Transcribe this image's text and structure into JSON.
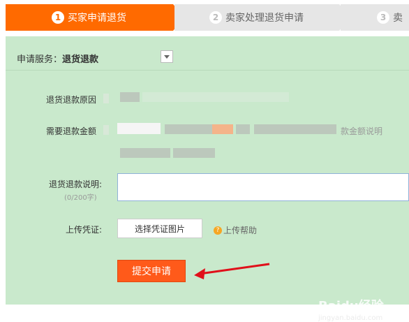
{
  "steps": [
    {
      "num": "1",
      "label": "买家申请退货"
    },
    {
      "num": "2",
      "label": "卖家处理退货申请"
    },
    {
      "num": "3",
      "label": "卖"
    }
  ],
  "service": {
    "label": "申请服务：",
    "value": "退货退款"
  },
  "form": {
    "reason_label": "退货退款原因",
    "amount_label": "需要退款金额",
    "amount_note": "款金额说明",
    "desc_label": "退货退款说明:",
    "desc_count": "(0/200字)",
    "voucher_label": "上传凭证:",
    "upload_button": "选择凭证图片",
    "help_link": "上传帮助",
    "submit_button": "提交申请"
  },
  "watermark": {
    "brand": "Baidu经验",
    "url": "jingyan.baidu.com"
  },
  "colors": {
    "accent": "#ff6a00",
    "panel": "#c9e9cc",
    "arrow": "#e0101a"
  }
}
